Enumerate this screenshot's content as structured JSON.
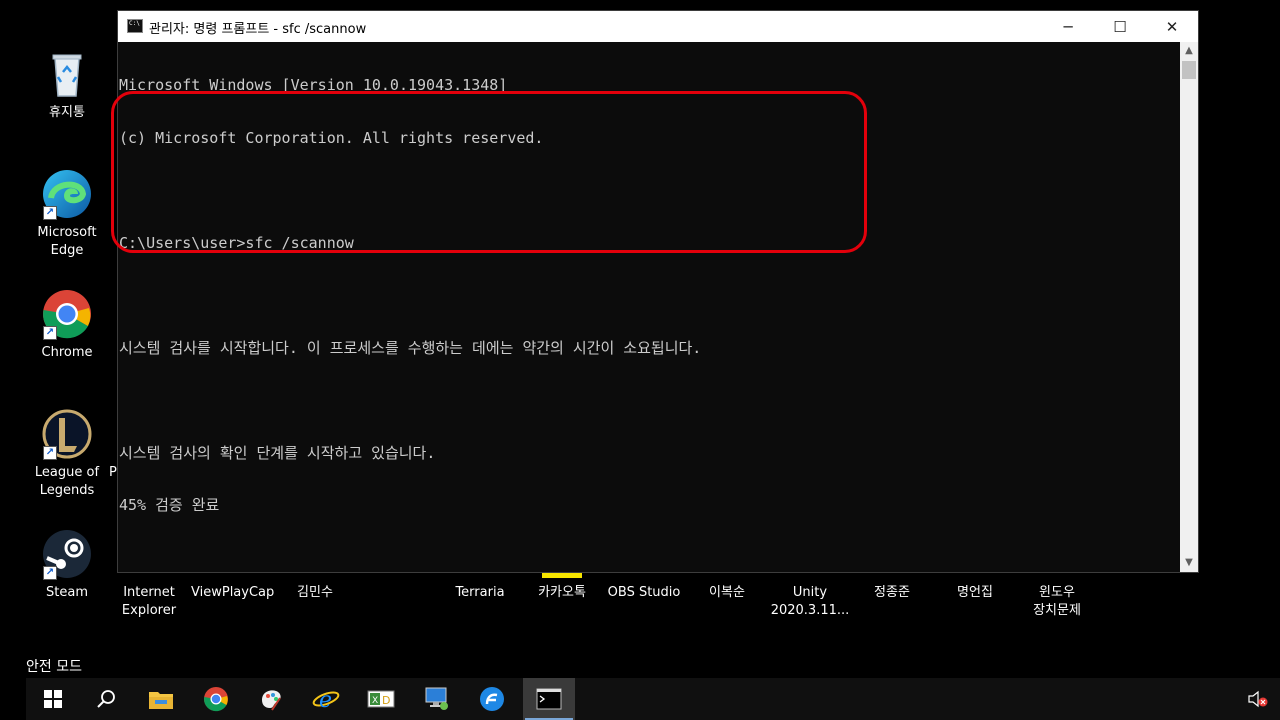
{
  "desktop": {
    "left_icons": [
      {
        "name": "recycle-bin",
        "label": "휴지통"
      },
      {
        "name": "microsoft-edge",
        "label": "Microsoft\nEdge"
      },
      {
        "name": "chrome",
        "label": "Chrome"
      },
      {
        "name": "league-of-legends",
        "label": "League of\nLegends"
      },
      {
        "name": "steam",
        "label": "Steam"
      }
    ],
    "partial_label": "P",
    "bottom_row": [
      {
        "label": "Internet\nExplorer"
      },
      {
        "label": "ViewPlayCap"
      },
      {
        "label": "김민수"
      },
      {
        "label": "Terraria"
      },
      {
        "label": "카카오톡"
      },
      {
        "label": "OBS Studio"
      },
      {
        "label": "이복순"
      },
      {
        "label": "Unity\n2020.3.11..."
      },
      {
        "label": "정종준"
      },
      {
        "label": "명언집"
      },
      {
        "label": "윈도우\n장치문제"
      }
    ],
    "safe_mode_label": "안전 모드"
  },
  "window": {
    "title": "관리자: 명령 프롬프트 - sfc  /scannow",
    "minimize_icon": "─",
    "maximize_icon": "☐",
    "close_icon": "✕",
    "console": {
      "line1": "Microsoft Windows [Version 10.0.19043.1348]",
      "line2": "(c) Microsoft Corporation. All rights reserved.",
      "line3": "C:\\Users\\user>sfc /scannow",
      "line4": "시스템 검사를 시작합니다. 이 프로세스를 수행하는 데에는 약간의 시간이 소요됩니다.",
      "line5": "시스템 검사의 확인 단계를 시작하고 있습니다.",
      "line6": "45% 검증 완료"
    },
    "verification_progress_percent": 45
  },
  "taskbar": {
    "items": [
      "start-icon",
      "search-icon",
      "file-explorer-icon",
      "chrome-icon",
      "paint-3d-icon",
      "internet-explorer-icon",
      "xd-icon",
      "remote-desktop-icon",
      "app-blue-icon",
      "command-prompt-icon"
    ],
    "active_item": "command-prompt-icon"
  },
  "colors": {
    "console_bg": "#0c0c0c",
    "console_text": "#cccccc",
    "highlight": "#e3000b"
  }
}
